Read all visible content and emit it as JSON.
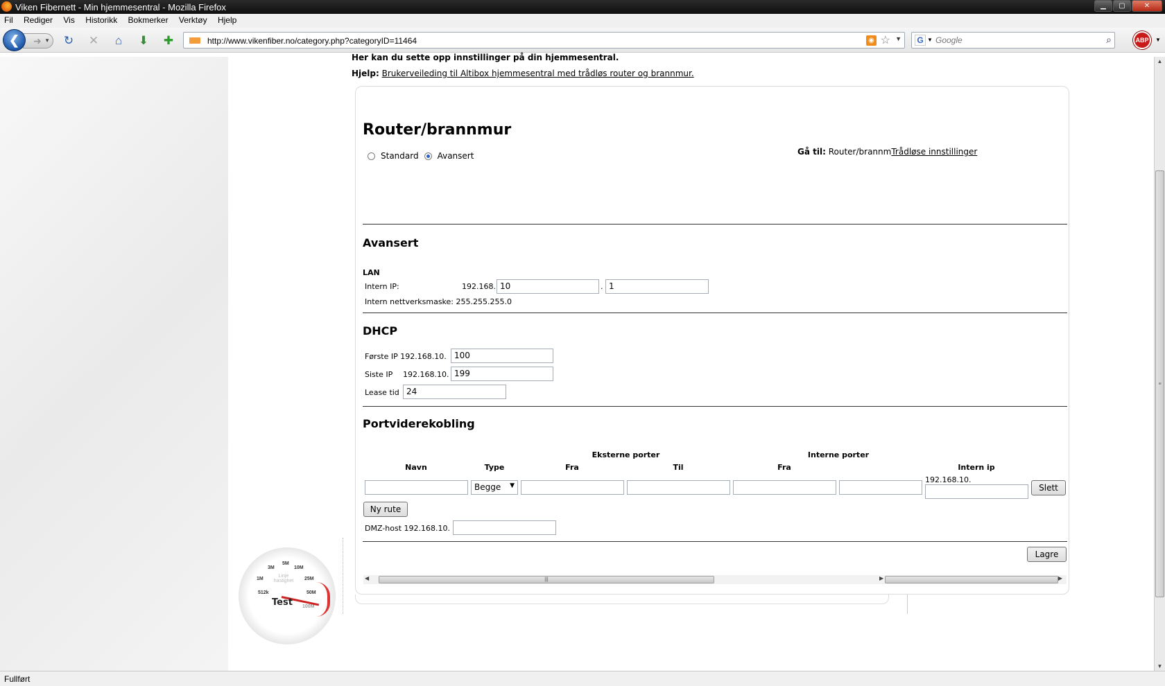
{
  "window": {
    "title": "Viken Fibernett - Min hjemmesentral - Mozilla Firefox",
    "buttons": {
      "minimize": "▁",
      "maximize": "▢",
      "close": "✕"
    }
  },
  "menu": [
    "Fil",
    "Rediger",
    "Vis",
    "Historikk",
    "Bokmerker",
    "Verktøy",
    "Hjelp"
  ],
  "toolbar": {
    "url": "http://www.vikenfiber.no/category.php?categoryID=11464",
    "search_placeholder": "Google",
    "abp_label": "ABP",
    "icons": [
      "back-icon",
      "forward-icon",
      "reload-icon",
      "stop-icon",
      "home-icon",
      "download-icon",
      "add-bookmark-icon",
      "rss-icon",
      "star-icon",
      "google-icon",
      "magnifier-icon"
    ]
  },
  "page": {
    "intro": "Her kan du sette opp innstillinger på din hjemmesentral.",
    "help_label": "Hjelp:",
    "help_link": "Brukerveileding til Altibox hjemmesentral med trådløs router og brannmur.",
    "title": "Router/brannmur",
    "mode": {
      "standard": "Standard",
      "advanced": "Avansert",
      "selected": "Avansert"
    },
    "goto": {
      "label": "Gå til:",
      "current": "Router/brannm",
      "link": "Trådløse innstillinger"
    },
    "advanced": {
      "heading": "Avansert",
      "lan_heading": "LAN",
      "intern_ip_label": "Intern IP:",
      "ip_prefix": "192.168.",
      "ip_octet3": "10",
      "ip_sep": ".",
      "ip_octet4": "1",
      "netmask_label": "Intern nettverksmaske: 255.255.255.0"
    },
    "dhcp": {
      "heading": "DHCP",
      "first_label": "Første IP 192.168.10.",
      "first_value": "100",
      "last_label": "Siste IP",
      "last_prefix": "192.168.10.",
      "last_value": "199",
      "lease_label": "Lease tid",
      "lease_value": "24"
    },
    "port_forwarding": {
      "heading": "Portviderekobling",
      "group_external": "Eksterne porter",
      "group_internal": "Interne porter",
      "col_name": "Navn",
      "col_type": "Type",
      "col_from": "Fra",
      "col_to": "Til",
      "col_from2": "Fra",
      "col_intern_ip": "Intern ip",
      "row_type": "Begge",
      "row_ip_prefix": "192.168.10.",
      "delete_label": "Slett",
      "new_route_label": "Ny rute",
      "dmz_label": "DMZ-host 192.168.10."
    },
    "save_label": "Lagre"
  },
  "gauge": {
    "marks": [
      "512k",
      "1M",
      "3M",
      "5M",
      "10M",
      "25M",
      "50M",
      "100M"
    ],
    "caption": "Linje hastighet",
    "test_label": "Test"
  },
  "statusbar": {
    "text": "Fullført"
  }
}
